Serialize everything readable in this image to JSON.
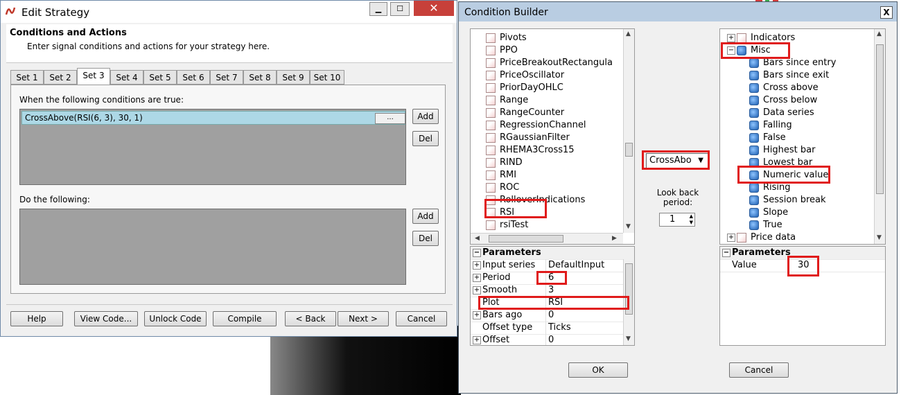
{
  "edit_strategy": {
    "window_title": "Edit Strategy",
    "header_title": "Conditions and Actions",
    "header_subtitle": "Enter signal conditions and actions for your strategy here.",
    "tabs": [
      "Set 1",
      "Set 2",
      "Set 3",
      "Set 4",
      "Set 5",
      "Set 6",
      "Set 7",
      "Set 8",
      "Set 9",
      "Set 10"
    ],
    "selected_tab": "Set 3",
    "conditions_label": "When the following conditions are true:",
    "condition_row": "CrossAbove(RSI(6, 3), 30, 1)",
    "ellipsis": "...",
    "add_label": "Add",
    "del_label": "Del",
    "actions_label": "Do the following:",
    "footer_buttons": [
      "Help",
      "View Code...",
      "Unlock Code",
      "Compile",
      "< Back",
      "Next >",
      "Cancel"
    ]
  },
  "condition_builder": {
    "window_title": "Condition Builder",
    "left_tree_items": [
      "Pivots",
      "PPO",
      "PriceBreakoutRectangula",
      "PriceOscillator",
      "PriorDayOHLC",
      "Range",
      "RangeCounter",
      "RegressionChannel",
      "RGaussianFilter",
      "RHEMA3Cross15",
      "RIND",
      "RMI",
      "ROC",
      "RolloverIndications",
      "RSI",
      "rsiTest"
    ],
    "highlighted_left": "RSI",
    "parameters_header": "Parameters",
    "left_params": [
      {
        "name": "Input series",
        "value": "DefaultInput",
        "expandable": true
      },
      {
        "name": "Period",
        "value": "6",
        "expandable": true
      },
      {
        "name": "Smooth",
        "value": "3",
        "expandable": true
      },
      {
        "name": "Plot",
        "value": "RSI",
        "expandable": false
      },
      {
        "name": "Bars ago",
        "value": "0",
        "expandable": true
      },
      {
        "name": "Offset type",
        "value": "Ticks",
        "expandable": false
      },
      {
        "name": "Offset",
        "value": "0",
        "expandable": true
      }
    ],
    "operator": "CrossAbo",
    "lookback_label": "Look back period:",
    "lookback_value": "1",
    "right_tree": {
      "indicators": "Indicators",
      "misc": "Misc",
      "misc_items": [
        "Bars since entry",
        "Bars since exit",
        "Cross above",
        "Cross below",
        "Data series",
        "Falling",
        "False",
        "Highest bar",
        "Lowest bar",
        "Numeric value",
        "Rising",
        "Session break",
        "Slope",
        "True"
      ],
      "price_data": "Price data"
    },
    "right_params": [
      {
        "name": "Value",
        "value": "30"
      }
    ],
    "ok_label": "OK",
    "cancel_label": "Cancel",
    "close_glyph": "X"
  }
}
